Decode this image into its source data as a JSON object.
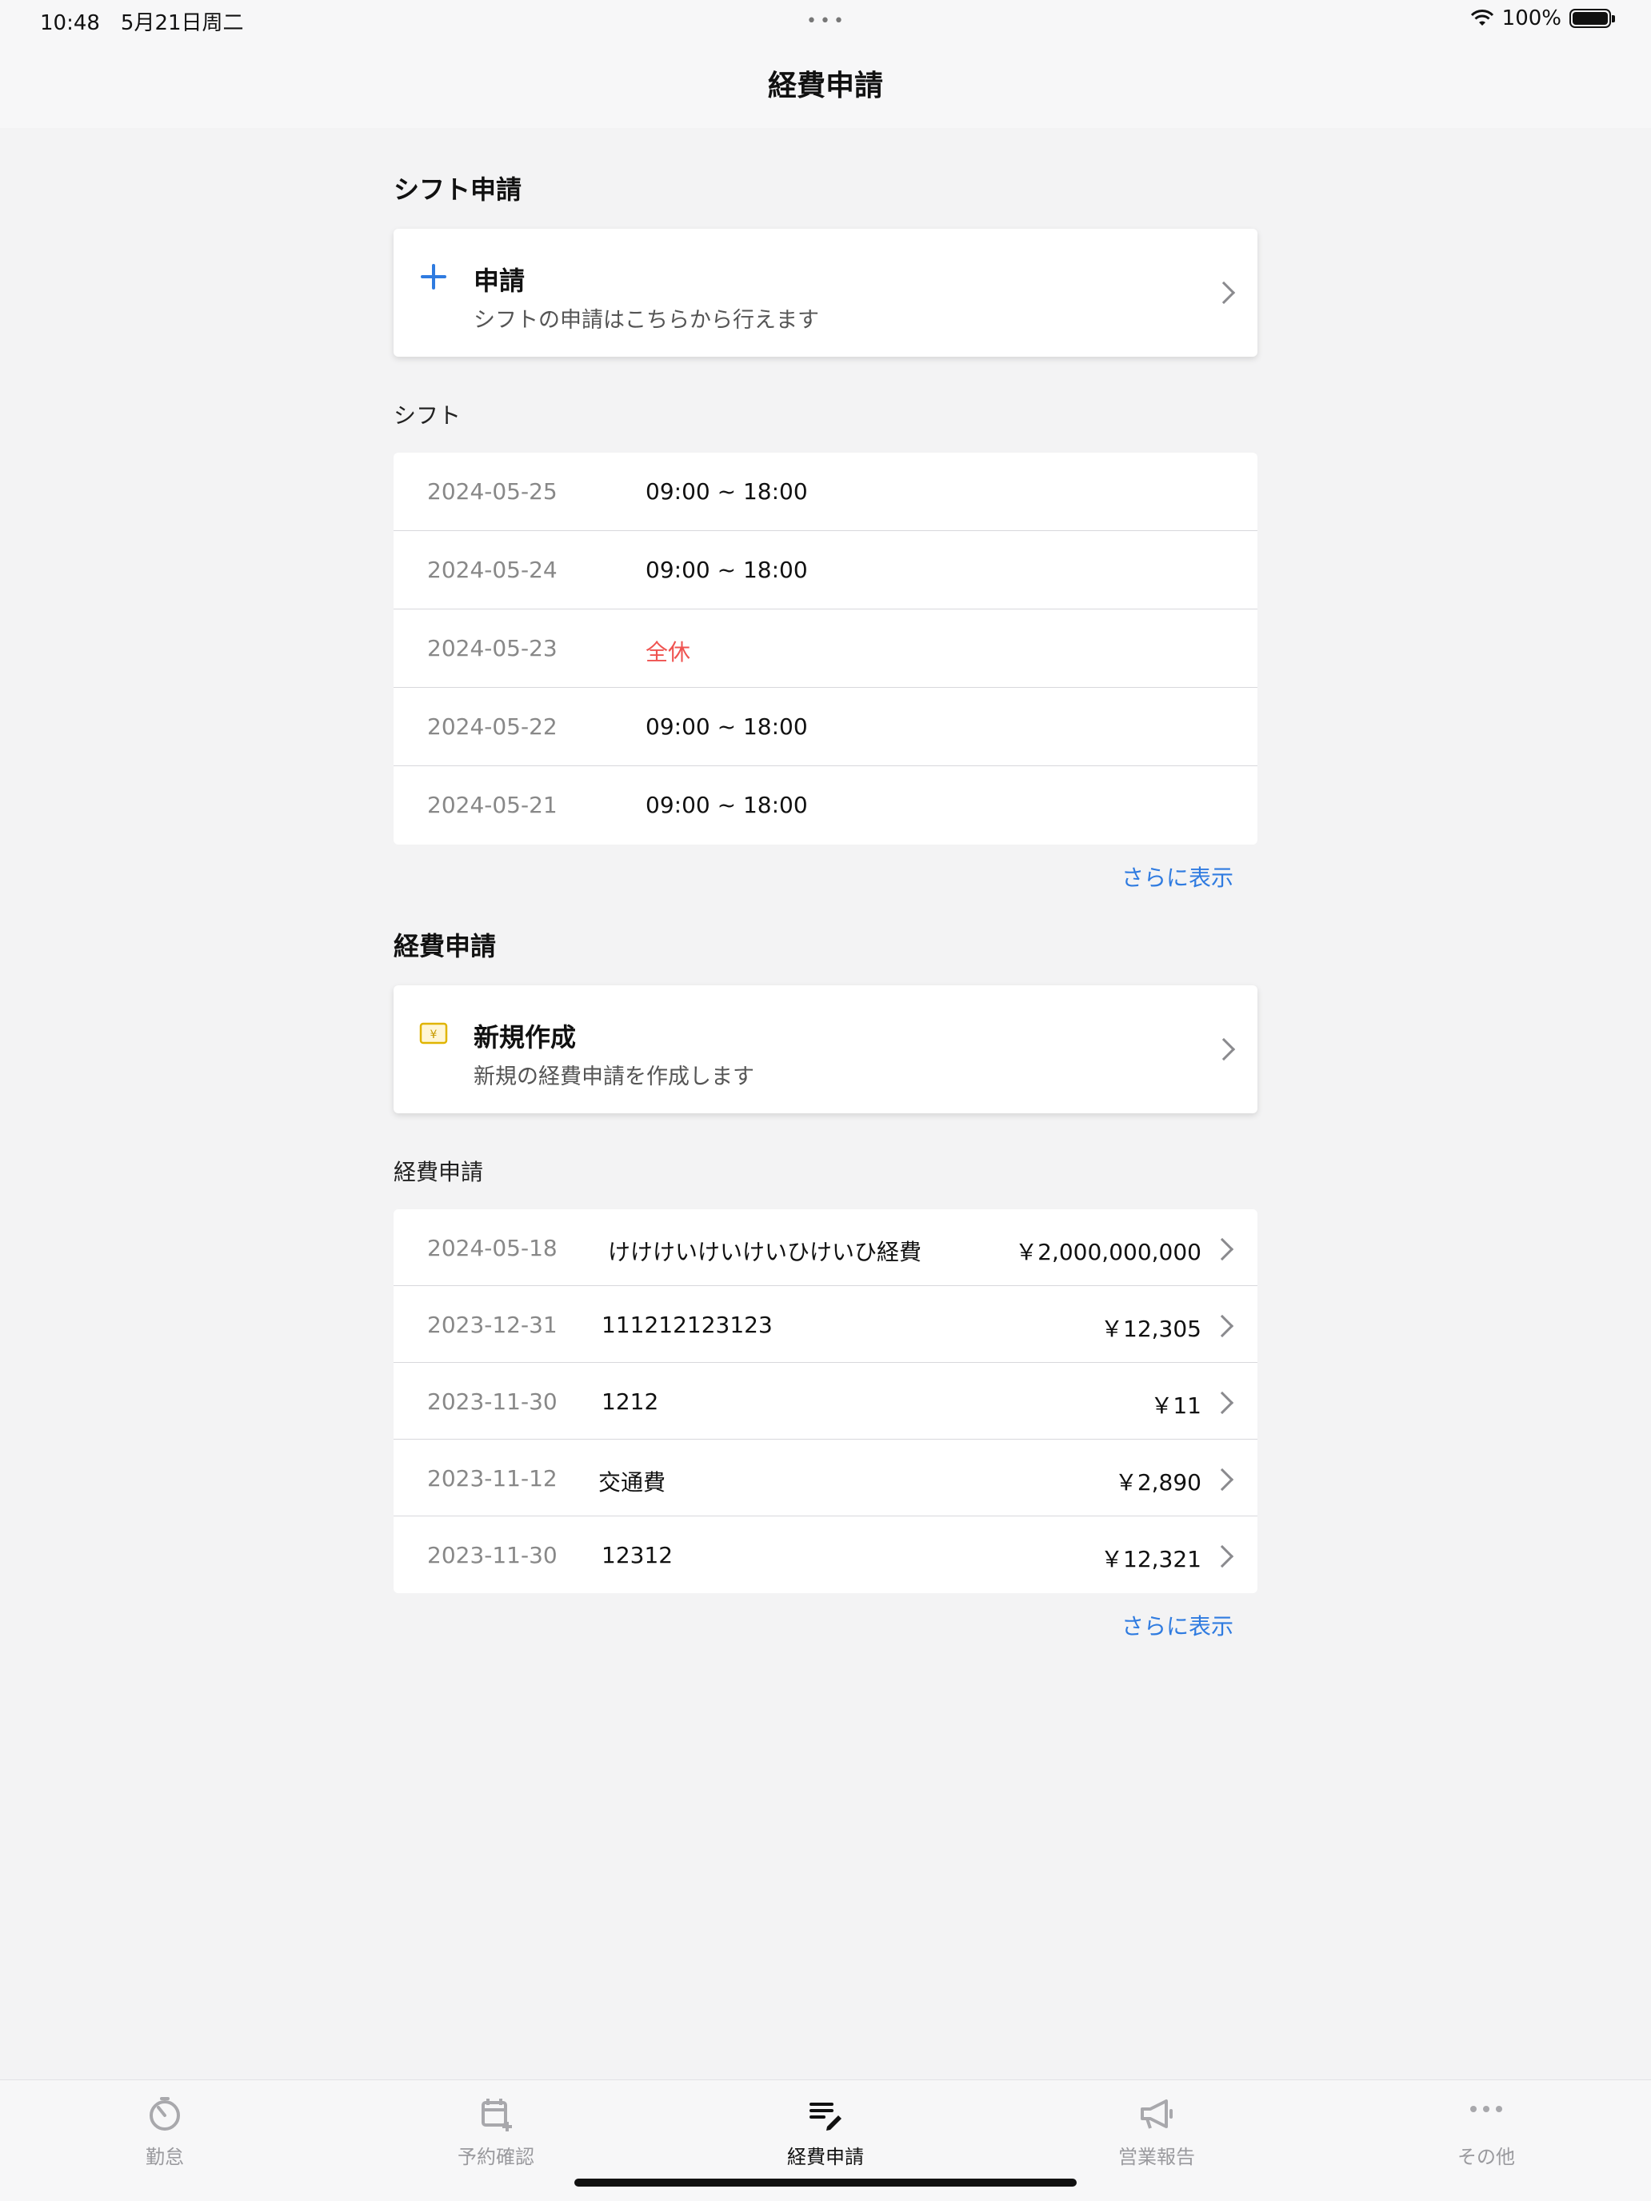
{
  "status_bar": {
    "time": "10:48　5月21日周二",
    "dots": "•••",
    "battery": "100%"
  },
  "nav": {
    "title": "経費申請"
  },
  "shift": {
    "section_title": "シフト申請",
    "action": {
      "title": "申請",
      "desc": "シフトの申請はこちらから行えます",
      "icon": "plus-icon"
    },
    "list_title": "シフト",
    "rows": [
      {
        "date": "2024-05-25",
        "value": "09:00 ~ 18:00",
        "off": false
      },
      {
        "date": "2024-05-24",
        "value": "09:00 ~ 18:00",
        "off": false
      },
      {
        "date": "2024-05-23",
        "value": "全休",
        "off": true
      },
      {
        "date": "2024-05-22",
        "value": "09:00 ~ 18:00",
        "off": false
      },
      {
        "date": "2024-05-21",
        "value": "09:00 ~ 18:00",
        "off": false
      }
    ],
    "more": "さらに表示"
  },
  "expense": {
    "section_title": "経費申請",
    "action": {
      "title": "新規作成",
      "desc": "新規の経費申請を作成します",
      "icon": "yen-card-icon"
    },
    "list_title": "経費申請",
    "rows": [
      {
        "date": "2024-05-18",
        "name": "けけけいけいけいひけいひ経費",
        "amount": "￥2,000,000,000"
      },
      {
        "date": "2023-12-31",
        "name": "111212123123",
        "amount": "￥12,305"
      },
      {
        "date": "2023-11-30",
        "name": "1212",
        "amount": "￥11"
      },
      {
        "date": "2023-11-12",
        "name": "交通費",
        "amount": "￥2,890"
      },
      {
        "date": "2023-11-30",
        "name": "12312",
        "amount": "￥12,321"
      }
    ],
    "more": "さらに表示"
  },
  "tabs": [
    {
      "label": "勤怠",
      "icon": "stopwatch-icon",
      "active": false
    },
    {
      "label": "予約確認",
      "icon": "calendar-add-icon",
      "active": false
    },
    {
      "label": "経費申請",
      "icon": "edit-list-icon",
      "active": true
    },
    {
      "label": "営業報告",
      "icon": "megaphone-icon",
      "active": false
    },
    {
      "label": "その他",
      "icon": "more-dots-icon",
      "active": false
    }
  ],
  "colors": {
    "accent": "#2f7be0",
    "off": "#ef5350",
    "yen_icon": "#e0b400"
  }
}
